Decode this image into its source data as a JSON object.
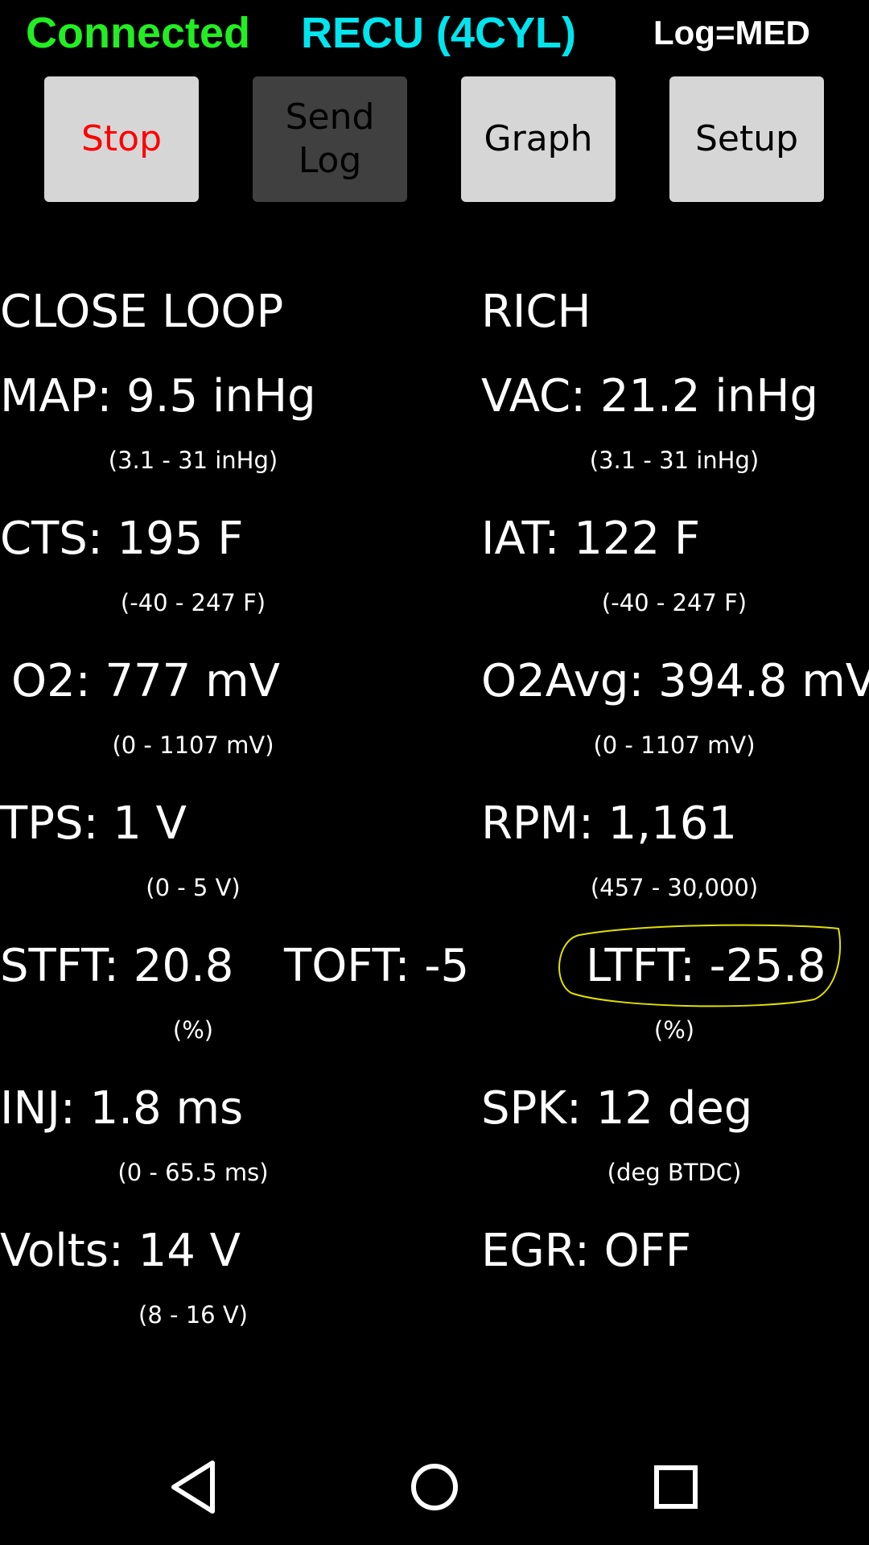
{
  "header": {
    "status": "Connected",
    "ecu": "RECU (4CYL)",
    "log": "Log=MED",
    "colors": {
      "status": "#22ee22",
      "ecu": "#00e5ee",
      "log": "#ffffff"
    }
  },
  "toolbar": {
    "stop_label": "Stop",
    "send_log_label": "Send\nLog",
    "graph_label": "Graph",
    "setup_label": "Setup",
    "stop_color": "#ff0000"
  },
  "status": {
    "loop": "CLOSE LOOP",
    "mixture": "RICH"
  },
  "readings": {
    "map": {
      "text": "MAP: 9.5 inHg",
      "range": "(3.1 - 31 inHg)"
    },
    "vac": {
      "text": "VAC: 21.2 inHg",
      "range": "(3.1 - 31 inHg)"
    },
    "cts": {
      "text": "CTS: 195 F",
      "range": "(-40 - 247 F)"
    },
    "iat": {
      "text": "IAT: 122 F",
      "range": "(-40 - 247 F)"
    },
    "o2": {
      "text": "O2: 777 mV",
      "range": "(0 - 1107 mV)"
    },
    "o2avg": {
      "text": "O2Avg: 394.8 mV",
      "range": "(0 - 1107 mV)"
    },
    "tps": {
      "text": "TPS: 1 V",
      "range": "(0 - 5 V)"
    },
    "rpm": {
      "text": "RPM: 1,161",
      "range": "(457 - 30,000)"
    },
    "stft": {
      "text": "STFT: 20.8",
      "range": "(%)"
    },
    "toft": {
      "text": "TOFT: -5"
    },
    "ltft": {
      "text": "LTFT: -25.8",
      "range": "(%)",
      "highlight_color": "#e0e000"
    },
    "inj": {
      "text": "INJ: 1.8 ms",
      "range": "(0 - 65.5 ms)"
    },
    "spk": {
      "text": "SPK: 12 deg",
      "range": "(deg BTDC)"
    },
    "volts": {
      "text": "Volts: 14 V",
      "range": "(8 - 16 V)"
    },
    "egr": {
      "text": "EGR: OFF"
    }
  },
  "navbar": {
    "back_icon": "back-triangle-icon",
    "home_icon": "home-circle-icon",
    "recents_icon": "recents-square-icon"
  }
}
